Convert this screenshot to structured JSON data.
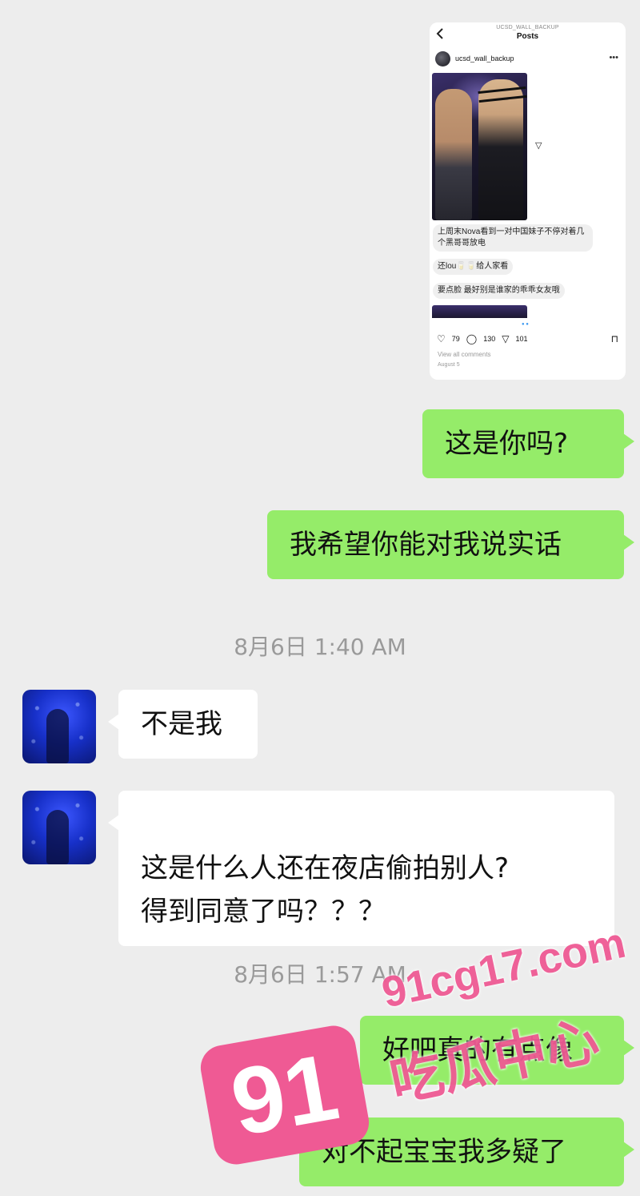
{
  "embedded_post": {
    "account_header": "UCSD_WALL_BACKUP",
    "title": "Posts",
    "username": "ucsd_wall_backup",
    "comments": [
      "上周末Nova看到一对中国妹子不停对着几个黑哥哥放电",
      "还lou🥛🥛给人家看",
      "要点脸 最好别是谁家的乖乖女友哦"
    ],
    "likes": "79",
    "comment_count": "130",
    "shares": "101",
    "view_all": "View all comments",
    "date": "August 5"
  },
  "messages": [
    {
      "sender": "me",
      "text": "这是你吗?"
    },
    {
      "sender": "me",
      "text": "我希望你能对我说实话"
    },
    {
      "sender": "timestamp",
      "text": "8月6日 1:40 AM"
    },
    {
      "sender": "them",
      "text": "不是我"
    },
    {
      "sender": "them",
      "text": "这是什么人还在夜店偷拍别人?\n得到同意了吗？？？"
    },
    {
      "sender": "timestamp",
      "text": "8月6日 1:57 AM"
    },
    {
      "sender": "me",
      "text": "好吧真的有点像"
    },
    {
      "sender": "me",
      "text": "对不起宝宝我多疑了"
    }
  ],
  "watermark": {
    "url": "91cg17.com",
    "logo": "91",
    "name": "吃瓜中心"
  },
  "colors": {
    "background": "#ededed",
    "my_bubble": "#95ec69",
    "their_bubble": "#ffffff",
    "watermark": "#ef5a94"
  },
  "icons": [
    "back-icon",
    "more-icon",
    "send-icon",
    "heart-icon",
    "comment-icon",
    "share-icon",
    "bookmark-icon"
  ]
}
